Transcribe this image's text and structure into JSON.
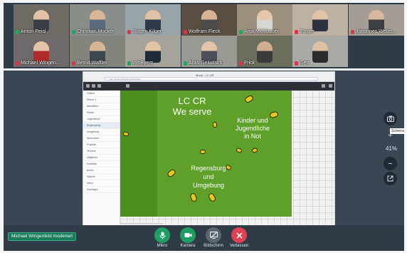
{
  "participants": [
    {
      "name": "Anton Peisl",
      "muted": false,
      "bg": "#6f6a63",
      "shirt": "#3a3f46",
      "skin": "#e4c1a4"
    },
    {
      "name": "Christian Mocker",
      "muted": false,
      "bg": "#8a8e8a",
      "shirt": "#5b6b7c",
      "skin": "#d9b596"
    },
    {
      "name": "Jürgen Kilger",
      "muted": true,
      "bg": "#99a4a9",
      "shirt": "#2e3a4a",
      "skin": "#e0c2a6"
    },
    {
      "name": "Wolfram Fleck",
      "muted": true,
      "bg": "#5a4e42",
      "shirt": "#4c4c4c",
      "skin": "#d8b495"
    },
    {
      "name": "Anja Mühlbauer",
      "muted": false,
      "bg": "#9c8f7d",
      "shirt": "#d8d6d0",
      "skin": "#e6c6ab"
    },
    {
      "name": "Zorger",
      "muted": true,
      "bg": "#bdb1a3",
      "shirt": "#2c3240",
      "skin": "#e2c3a5"
    },
    {
      "name": "Johannes Wetzs...",
      "muted": true,
      "bg": "#a39d95",
      "shirt": "#3c3e44",
      "skin": "#d8b89c"
    },
    {
      "name": "Michael Wingen...",
      "muted": true,
      "bg": "#6f6a69",
      "shirt": "#b02c2c",
      "skin": "#e6c4a8"
    },
    {
      "name": "Bernd Waffler",
      "muted": true,
      "bg": "#83847c",
      "shirt": "#3e4650",
      "skin": "#d7b597"
    },
    {
      "name": "vonByern",
      "muted": false,
      "bg": "#a5a39a",
      "shirt": "#1f2a38",
      "skin": "#e3c4a7"
    },
    {
      "name": "Alois Geiwitsch",
      "muted": false,
      "bg": "#9a9a94",
      "shirt": "#4a4f58",
      "skin": "#e2c4a8"
    },
    {
      "name": "Frick",
      "muted": true,
      "bg": "#6a6e5a",
      "shirt": "#3a3a3a",
      "skin": "#d2ae90"
    },
    {
      "name": "Gert",
      "muted": true,
      "bg": "#a9aaa6",
      "shirt": "#2b2b2b",
      "skin": "#dfc1a4"
    }
  ],
  "screen": {
    "tab_title": "Mural - LC CR",
    "url": "app.mural.co/t/lions/m/lccr/board",
    "sidebar_rows": [
      "Outline",
      "Ebene 1",
      "Aktivitäten",
      "Kinder",
      "Jugendliche",
      "Regensburg",
      "Umgebung",
      "Sponsoren",
      "Projekte",
      "Termine",
      "Mitglieder",
      "Kontakte",
      "Archiv",
      "Notizen",
      "Ideen",
      "Sonstiges"
    ],
    "slide": {
      "title_line1": "LC CR",
      "title_line2": "We serve",
      "text_right_1": "Kinder und",
      "text_right_2": "Jugendliche",
      "text_right_3": "in Not",
      "text_left_1": "Regensburg",
      "text_left_2": "und",
      "text_left_3": "Umgebung"
    }
  },
  "floating": {
    "zoom_label": "41%",
    "tooltip": "Screenshot"
  },
  "presenter_label": "Michael Wingenfeld moderiert",
  "controls": [
    {
      "label": "Mikro",
      "color": "#1f9e63"
    },
    {
      "label": "Kamera",
      "color": "#1f9e63"
    },
    {
      "label": "Bildschirm",
      "color": "#5b6670"
    },
    {
      "label": "Verlassen",
      "color": "#e04054"
    }
  ]
}
